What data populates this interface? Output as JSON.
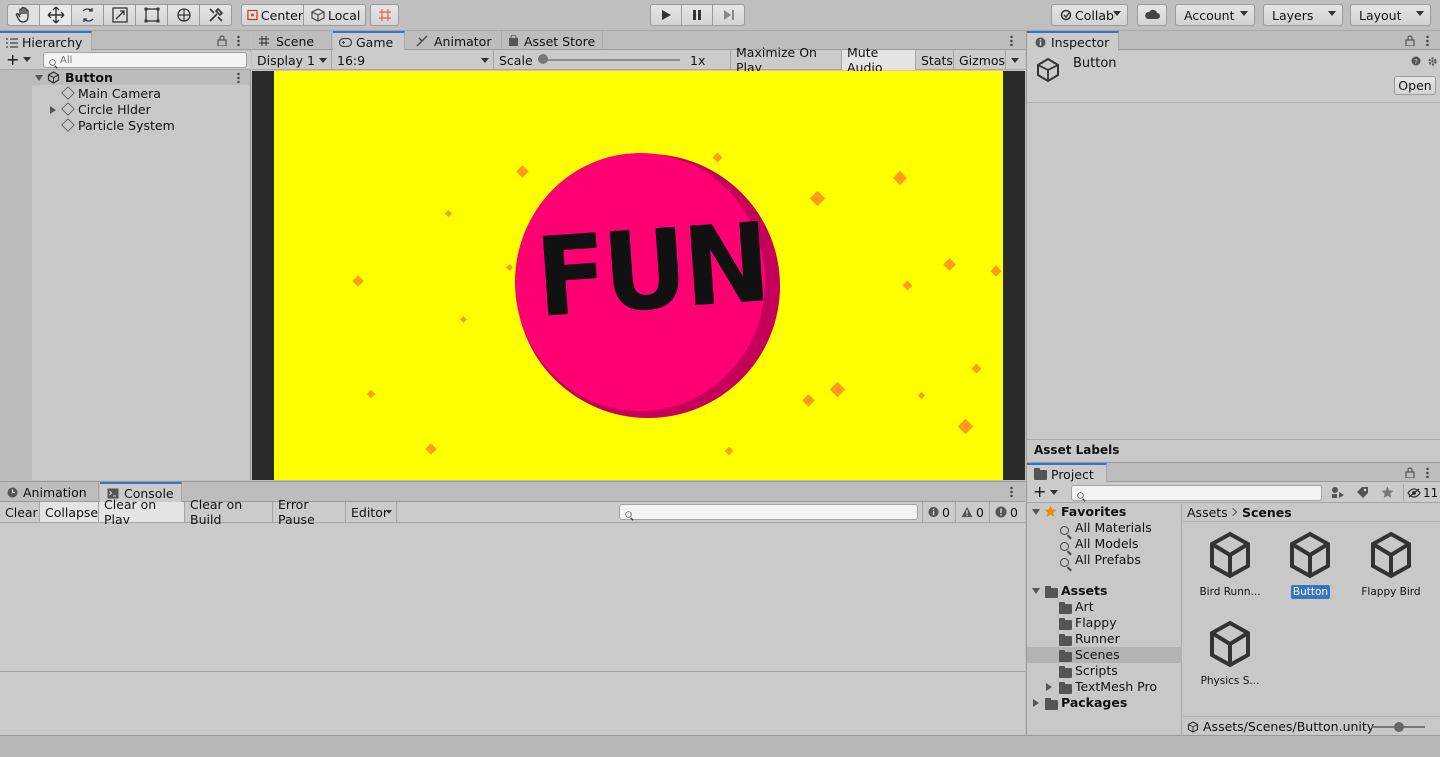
{
  "toolbar": {
    "tools": [
      "hand-tool-icon",
      "move-tool-icon",
      "rotate-tool-icon",
      "scale-tool-icon",
      "rect-tool-icon",
      "transform-tool-icon",
      "custom-tool-icon"
    ],
    "pivot_label": "Center",
    "space_label": "Local",
    "collab_label": "Collab",
    "account_label": "Account",
    "layers_label": "Layers",
    "layout_label": "Layout"
  },
  "hierarchy": {
    "tab_label": "Hierarchy",
    "search_placeholder": "All",
    "scene_name": "Button",
    "items": [
      {
        "label": "Main Camera"
      },
      {
        "label": "Circle Hlder"
      },
      {
        "label": "Particle System"
      }
    ]
  },
  "center_tabs": {
    "scene": "Scene",
    "game": "Game",
    "animator": "Animator",
    "asset_store": "Asset Store"
  },
  "game_toolbar": {
    "display": "Display 1",
    "aspect": "16:9",
    "scale_label": "Scale",
    "scale_value": "1x",
    "maximize": "Maximize On Play",
    "mute": "Mute Audio",
    "stats": "Stats",
    "gizmos": "Gizmos"
  },
  "game_view": {
    "button_text": "FUN",
    "colors": {
      "background": "#ffff00",
      "button": "#ff0073",
      "button_shadow": "#c4005a",
      "confetti": "#ff9a1a"
    }
  },
  "inspector": {
    "tab_label": "Inspector",
    "asset_name": "Button",
    "open_label": "Open",
    "asset_labels": "Asset Labels"
  },
  "console": {
    "tab_animation": "Animation",
    "tab_console": "Console",
    "clear": "Clear",
    "collapse": "Collapse",
    "clear_on_play": "Clear on Play",
    "clear_on_build": "Clear on Build",
    "error_pause": "Error Pause",
    "editor": "Editor",
    "info_count": "0",
    "warn_count": "0",
    "error_count": "0"
  },
  "project": {
    "tab_label": "Project",
    "hidden_count": "11",
    "favorites_label": "Favorites",
    "favorites": [
      "All Materials",
      "All Models",
      "All Prefabs"
    ],
    "assets_label": "Assets",
    "folders": [
      "Art",
      "Flappy",
      "Runner",
      "Scenes",
      "Scripts",
      "TextMesh Pro"
    ],
    "packages_label": "Packages",
    "breadcrumb_root": "Assets",
    "breadcrumb_current": "Scenes",
    "scene_files": [
      "Bird Runn...",
      "Button",
      "Flappy Bird",
      "Physics S..."
    ],
    "path": "Assets/Scenes/Button.unity"
  }
}
